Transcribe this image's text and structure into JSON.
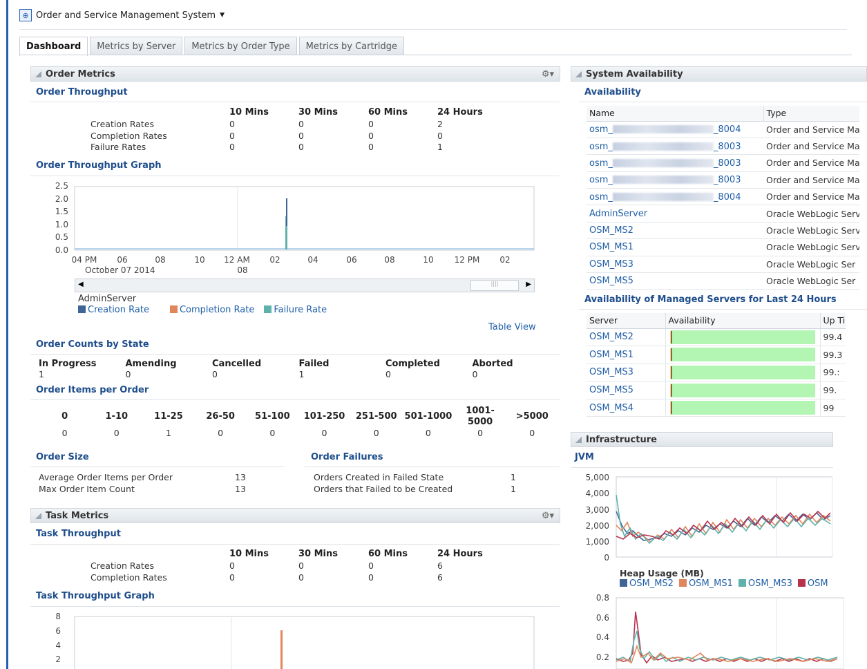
{
  "app": {
    "title": "Order and Service Management System"
  },
  "tabs": [
    "Dashboard",
    "Metrics by Server",
    "Metrics by Order Type",
    "Metrics by Cartridge"
  ],
  "order_metrics": {
    "title": "Order Metrics",
    "throughput": {
      "title": "Order Throughput",
      "columns": [
        "10 Mins",
        "30 Mins",
        "60 Mins",
        "24 Hours"
      ],
      "rows": [
        {
          "label": "Creation Rates",
          "values": [
            "0",
            "0",
            "0",
            "2"
          ]
        },
        {
          "label": "Completion Rates",
          "values": [
            "0",
            "0",
            "0",
            "0"
          ]
        },
        {
          "label": "Failure Rates",
          "values": [
            "0",
            "0",
            "0",
            "1"
          ]
        }
      ]
    },
    "graph": {
      "title": "Order Throughput Graph",
      "yticks": [
        "2.5",
        "2.0",
        "1.5",
        "1.0",
        "0.5",
        "0.0"
      ],
      "xticks": [
        "04 PM",
        "06",
        "08",
        "10",
        "12 AM",
        "02",
        "04",
        "06",
        "08",
        "10",
        "12 PM",
        "02"
      ],
      "date_label": "October 07 2014",
      "midnight_sub": "08",
      "series_group": "AdminServer",
      "legend": [
        {
          "name": "Creation Rate",
          "color": "#3f6496"
        },
        {
          "name": "Completion Rate",
          "color": "#e0865a"
        },
        {
          "name": "Failure Rate",
          "color": "#5eb2ab"
        }
      ],
      "table_view": "Table View"
    },
    "counts": {
      "title": "Order Counts by State",
      "states": [
        {
          "label": "In Progress",
          "value": "1"
        },
        {
          "label": "Amending",
          "value": "0"
        },
        {
          "label": "Cancelled",
          "value": "0"
        },
        {
          "label": "Failed",
          "value": "1"
        },
        {
          "label": "Completed",
          "value": "0"
        },
        {
          "label": "Aborted",
          "value": "0"
        }
      ]
    },
    "items": {
      "title": "Order Items per Order",
      "buckets": [
        {
          "label": "0",
          "value": "0"
        },
        {
          "label": "1-10",
          "value": "0"
        },
        {
          "label": "11-25",
          "value": "1"
        },
        {
          "label": "26-50",
          "value": "0"
        },
        {
          "label": "51-100",
          "value": "0"
        },
        {
          "label": "101-250",
          "value": "0"
        },
        {
          "label": "251-500",
          "value": "0"
        },
        {
          "label": "501-1000",
          "value": "0"
        },
        {
          "label": "1001-\n5000",
          "value": "0"
        },
        {
          "label": ">5000",
          "value": "0"
        }
      ]
    },
    "size": {
      "title": "Order Size",
      "rows": [
        {
          "label": "Average Order Items per Order",
          "value": "13"
        },
        {
          "label": "Max Order Item Count",
          "value": "13"
        }
      ]
    },
    "failures": {
      "title": "Order Failures",
      "rows": [
        {
          "label": "Orders Created in Failed State",
          "value": "1"
        },
        {
          "label": "Orders that Failed to be Created",
          "value": "1"
        }
      ]
    }
  },
  "task_metrics": {
    "title": "Task Metrics",
    "throughput": {
      "title": "Task Throughput",
      "columns": [
        "10 Mins",
        "30 Mins",
        "60 Mins",
        "24 Hours"
      ],
      "rows": [
        {
          "label": "Creation Rates",
          "values": [
            "0",
            "0",
            "0",
            "6"
          ]
        },
        {
          "label": "Completion Rates",
          "values": [
            "0",
            "0",
            "0",
            "6"
          ]
        }
      ]
    },
    "graph": {
      "title": "Task Throughput Graph",
      "yticks": [
        "8",
        "6",
        "4",
        "2"
      ]
    }
  },
  "system_availability": {
    "title": "System Availability",
    "availability_title": "Availability",
    "columns": [
      "Name",
      "Type"
    ],
    "rows": [
      {
        "prefix": "osm_",
        "suffix": "_8004",
        "type": "Order and Service Ma"
      },
      {
        "prefix": "osm_",
        "suffix": "_8003",
        "type": "Order and Service Mai"
      },
      {
        "prefix": "osm_",
        "suffix": "_8003",
        "type": "Order and Service Mai"
      },
      {
        "prefix": "osm_",
        "suffix": "_8003",
        "type": "Order and Service Mai"
      },
      {
        "prefix": "osm_",
        "suffix": "_8004",
        "type": "Order and Service Mai"
      },
      {
        "name": "AdminServer",
        "type": "Oracle WebLogic Serv"
      },
      {
        "name": "OSM_MS2",
        "type": "Oracle WebLogic Serv"
      },
      {
        "name": "OSM_MS1",
        "type": "Oracle WebLogic Serv"
      },
      {
        "name": "OSM_MS3",
        "type": "Oracle WebLogic Ser"
      },
      {
        "name": "OSM_MS5",
        "type": "Oracle WebLogic Ser"
      }
    ],
    "managed_title": "Availability of Managed Servers for Last 24 Hours",
    "managed_columns": [
      "Server",
      "Availability",
      "Up Ti"
    ],
    "managed_rows": [
      {
        "server": "OSM_MS2",
        "uptime": "99.4"
      },
      {
        "server": "OSM_MS1",
        "uptime": "99.3"
      },
      {
        "server": "OSM_MS3",
        "uptime": "99.:"
      },
      {
        "server": "OSM_MS5",
        "uptime": "99."
      },
      {
        "server": "OSM_MS4",
        "uptime": "99"
      }
    ]
  },
  "infrastructure": {
    "title": "Infrastructure",
    "jvm_title": "JVM",
    "heap_yticks": [
      "5,000",
      "4,000",
      "3,000",
      "2,000",
      "1,000",
      "0"
    ],
    "heap_title": "Heap Usage (MB)",
    "heap_legend": [
      {
        "name": "OSM_MS2",
        "color": "#3f6496"
      },
      {
        "name": "OSM_MS1",
        "color": "#e0865a"
      },
      {
        "name": "OSM_MS3",
        "color": "#5eb2ab"
      },
      {
        "name": "OSM",
        "color": "#b8324e"
      }
    ],
    "cpu_yticks": [
      "0.8",
      "0.6",
      "0.4",
      "0.2"
    ]
  }
}
